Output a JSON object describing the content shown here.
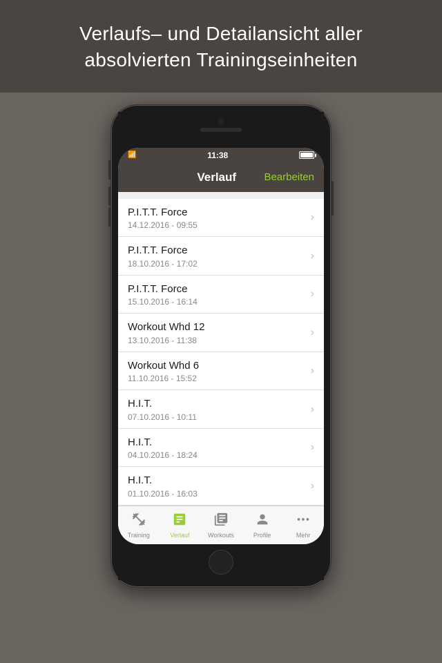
{
  "banner": {
    "text": "Verlaufs– und Detail­ansicht aller absolvierten Trainingseinheiten"
  },
  "phone": {
    "status": {
      "time": "11:38",
      "wifi": "WiFi",
      "battery": "100%"
    },
    "navbar": {
      "title": "Verlauf",
      "edit_button": "Bearbeiten"
    },
    "list": {
      "items": [
        {
          "title": "P.I.T.T. Force",
          "subtitle": "14.12.2016 - 09:55"
        },
        {
          "title": "P.I.T.T. Force",
          "subtitle": "18.10.2016 - 17:02"
        },
        {
          "title": "P.I.T.T. Force",
          "subtitle": "15.10.2016 - 16:14"
        },
        {
          "title": "Workout Whd 12",
          "subtitle": "13.10.2016 - 11:38"
        },
        {
          "title": "Workout Whd 6",
          "subtitle": "11.10.2016 - 15:52"
        },
        {
          "title": "H.I.T.",
          "subtitle": "07.10.2016 - 10:11"
        },
        {
          "title": "H.I.T.",
          "subtitle": "04.10.2016 - 18:24"
        },
        {
          "title": "H.I.T.",
          "subtitle": "01.10.2016 - 16:03"
        }
      ]
    },
    "tabs": [
      {
        "id": "training",
        "label": "Training",
        "active": false
      },
      {
        "id": "verlauf",
        "label": "Verlauf",
        "active": true
      },
      {
        "id": "workouts",
        "label": "Workouts",
        "active": false
      },
      {
        "id": "profile",
        "label": "Profile",
        "active": false
      },
      {
        "id": "mehr",
        "label": "Mehr",
        "active": false
      }
    ]
  }
}
